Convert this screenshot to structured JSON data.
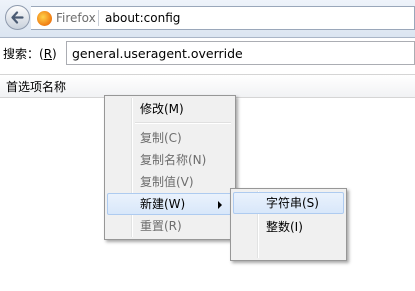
{
  "navbar": {
    "identity_label": "Firefox",
    "url": "about:config"
  },
  "search": {
    "label_prefix": "搜索：(",
    "label_key": "R",
    "label_suffix": ")",
    "value": "general.useragent.override"
  },
  "list": {
    "column_name": "首选项名称"
  },
  "context_menu": {
    "items": [
      {
        "label": "修改(M)",
        "enabled": true
      },
      {
        "label": "复制(C)",
        "enabled": false
      },
      {
        "label": "复制名称(N)",
        "enabled": false
      },
      {
        "label": "复制值(V)",
        "enabled": false
      },
      {
        "label": "新建(W)",
        "enabled": true,
        "has_submenu": true
      },
      {
        "label": "重置(R)",
        "enabled": false
      }
    ]
  },
  "submenu": {
    "items": [
      {
        "label": "字符串(S)",
        "enabled": true
      },
      {
        "label": "整数(I)",
        "enabled": true
      }
    ]
  },
  "icons": {
    "back": "back-arrow-icon",
    "identity": "firefox-logo-icon",
    "submenu": "submenu-arrow-icon"
  },
  "colors": {
    "navbar_bg": "#dbe5f1",
    "menu_bg": "#f0f0f0",
    "hover_bg": "#d8e7fa",
    "disabled_text": "#6d6d6d"
  }
}
